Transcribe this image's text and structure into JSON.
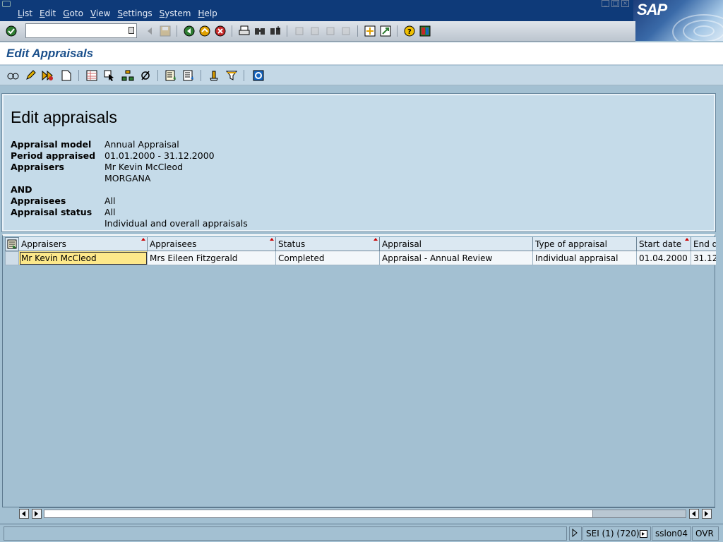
{
  "menubar": {
    "items": [
      "List",
      "Edit",
      "Goto",
      "View",
      "Settings",
      "System",
      "Help"
    ],
    "logo_text": "SAP"
  },
  "command_field": {
    "value": ""
  },
  "title": "Edit Appraisals",
  "header": {
    "heading": "Edit appraisals",
    "rows": [
      {
        "key": "Appraisal model",
        "value": "Annual Appraisal"
      },
      {
        "key": "Period appraised",
        "value": "01.01.2000 - 31.12.2000"
      },
      {
        "key": "Appraisers",
        "value": "Mr Kevin McCleod"
      },
      {
        "key": "",
        "value": "MORGANA"
      },
      {
        "key": "AND",
        "value": ""
      },
      {
        "key": "Appraisees",
        "value": "All"
      },
      {
        "key": "Appraisal status",
        "value": "All"
      },
      {
        "key": "",
        "value": "Individual and overall appraisals"
      }
    ]
  },
  "table": {
    "columns": [
      "Appraisers",
      "Appraisees",
      "Status",
      "Appraisal",
      "Type of appraisal",
      "Start date",
      "End d"
    ],
    "rows": [
      [
        "Mr Kevin McCleod",
        "Mrs Eileen Fitzgerald",
        "Completed",
        "Appraisal - Annual Review",
        "Individual appraisal",
        "01.04.2000",
        "31.12"
      ]
    ]
  },
  "statusbar": {
    "session": "SEI (1) (720)",
    "server": "sslon04",
    "mode": "OVR"
  },
  "colors": {
    "menubar_bg": "#0e3a79",
    "title_text": "#1a4f8b",
    "panel_bg": "#c5dbe9",
    "selected_cell": "#fde88a"
  }
}
